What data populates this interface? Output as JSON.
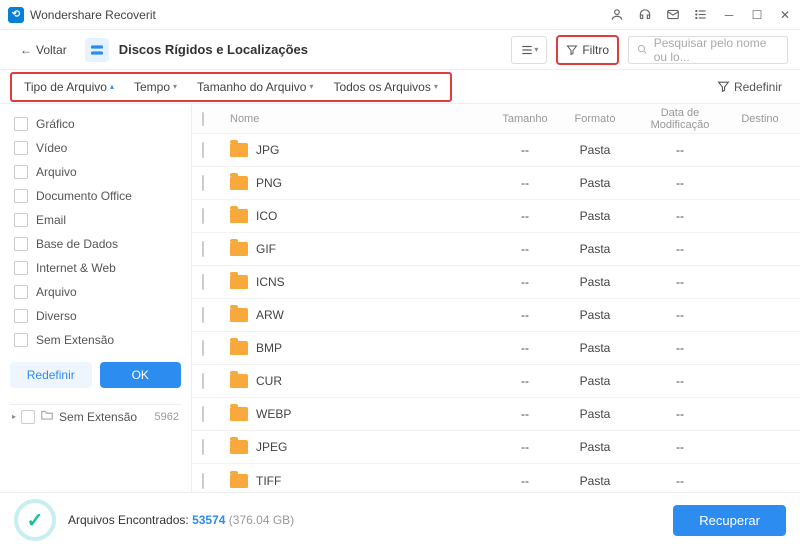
{
  "app": {
    "title": "Wondershare Recoverit"
  },
  "toolbar": {
    "back": "Voltar",
    "crumb": "Discos Rígidos e Localizações",
    "filter": "Filtro",
    "search_placeholder": "Pesquisar pelo nome ou lo..."
  },
  "filters": {
    "chips": [
      {
        "label": "Tipo de Arquivo",
        "active": true
      },
      {
        "label": "Tempo",
        "active": false
      },
      {
        "label": "Tamanho do Arquivo",
        "active": false
      },
      {
        "label": "Todos os Arquivos",
        "active": false
      }
    ],
    "reset": "Redefinir"
  },
  "sidebar": {
    "categories": [
      "Gráfico",
      "Vídeo",
      "Arquivo",
      "Documento Office",
      "Email",
      "Base de Dados",
      "Internet & Web",
      "Arquivo",
      "Diverso",
      "Sem Extensão"
    ],
    "reset": "Redefinir",
    "ok": "OK",
    "tree": {
      "label": "Sem Extensão",
      "count": "5962"
    }
  },
  "table": {
    "headers": {
      "name": "Nome",
      "size": "Tamanho",
      "format": "Formato",
      "date": "Data de Modificação",
      "dest": "Destino"
    },
    "rows": [
      {
        "name": "JPG",
        "size": "--",
        "format": "Pasta",
        "date": "--"
      },
      {
        "name": "PNG",
        "size": "--",
        "format": "Pasta",
        "date": "--"
      },
      {
        "name": "ICO",
        "size": "--",
        "format": "Pasta",
        "date": "--"
      },
      {
        "name": "GIF",
        "size": "--",
        "format": "Pasta",
        "date": "--"
      },
      {
        "name": "ICNS",
        "size": "--",
        "format": "Pasta",
        "date": "--"
      },
      {
        "name": "ARW",
        "size": "--",
        "format": "Pasta",
        "date": "--"
      },
      {
        "name": "BMP",
        "size": "--",
        "format": "Pasta",
        "date": "--"
      },
      {
        "name": "CUR",
        "size": "--",
        "format": "Pasta",
        "date": "--"
      },
      {
        "name": "WEBP",
        "size": "--",
        "format": "Pasta",
        "date": "--"
      },
      {
        "name": "JPEG",
        "size": "--",
        "format": "Pasta",
        "date": "--"
      },
      {
        "name": "TIFF",
        "size": "--",
        "format": "Pasta",
        "date": "--"
      }
    ]
  },
  "footer": {
    "found_label": "Arquivos Encontrados:",
    "found_count": "53574",
    "found_size": "(376.04 GB)",
    "recover": "Recuperar"
  }
}
